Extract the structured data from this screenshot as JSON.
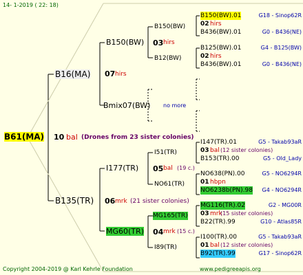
{
  "header": {
    "date": "14-  1-2019  ( 22:  18)"
  },
  "footer": {
    "copyright": "Copyright 2004-2019 @ Karl Kehrle Foundation",
    "site": "www.pedigreeapis.org"
  },
  "colors": {
    "background": "#ffffe6",
    "yellow": "#ffff00",
    "green": "#33cc33",
    "cyan": "#33ccff",
    "red": "#cc0000",
    "blue": "#0000aa",
    "purple": "#660066"
  },
  "root": {
    "name": "B61(MA)",
    "num": "10",
    "tag": "bal",
    "note": "(Drones from 23 sister colonies)"
  },
  "g1": {
    "upper": {
      "name": "B16(MA)",
      "num": "07",
      "tag": "hirs"
    },
    "lower": {
      "name": "B135(TR)",
      "num": "06",
      "tag": "mrk",
      "note": "(21 sister colonies)"
    }
  },
  "g2": {
    "a": {
      "name": "B150(BW)",
      "num": "03",
      "tag": "hirs"
    },
    "b": {
      "name": "Bmix07(BW)",
      "note": "no more"
    },
    "c": {
      "name": "I177(TR)",
      "num": "05",
      "tag": "bal",
      "note": "(19 c.)"
    },
    "d": {
      "name": "MG60(TR)",
      "num": "04",
      "tag": "mrk",
      "note": "(15 c.)"
    }
  },
  "g3": {
    "a": {
      "name": "B150(BW)",
      "num": "03",
      "tag": "hirs"
    },
    "b": {
      "name": "B12(BW)"
    },
    "c": {
      "name": "I51(TR)",
      "num": "05",
      "tag": "bal",
      "note": "(19 c.)"
    },
    "d": {
      "name": "NO61(TR)"
    },
    "e": {
      "name": "MG165(TR)",
      "num": "04",
      "tag": "mrk",
      "note": "(15 c.)"
    },
    "f": {
      "name": "I89(TR)"
    }
  },
  "g4": [
    {
      "top": "B150(BW).01",
      "num": "02",
      "tag": "hirs",
      "bot": "B436(BW).01",
      "gtop": "G18 - Sinop62R",
      "gbot": "G0 - B436(NE)"
    },
    {
      "top": "B125(BW).01",
      "num": "02",
      "tag": "hirs",
      "bot": "B436(BW).01",
      "gtop": "G4 - B125(BW)",
      "gbot": "G0 - B436(NE)"
    },
    {
      "top": "I147(TR).01",
      "num": "03",
      "tag": "bal",
      "note": "(12 sister colonies)",
      "bot": "B153(TR).00",
      "gtop": "G5 - Takab93aR",
      "gbot": "G5 - Old_Lady"
    },
    {
      "top": "NO638(PN).00",
      "num": "01",
      "tag": "hbpn",
      "bot": "NO6238b(PN).98",
      "gtop": "G5 - NO6294R",
      "gbot": "G4 - NO6294R"
    },
    {
      "top": "MG116(TR).02",
      "num": "03",
      "tag": "mrk",
      "note": "(15 sister colonies)",
      "bot": "B22(TR).99",
      "gtop": "G2 - MG00R",
      "gbot": "G10 - Atlas85R"
    },
    {
      "top": "I100(TR).00",
      "num": "01",
      "tag": "bal",
      "note": "(12 sister colonies)",
      "bot": "B92(TR).99",
      "gtop": "G5 - Takab93aR",
      "gbot": "G17 - Sinop62R"
    }
  ]
}
